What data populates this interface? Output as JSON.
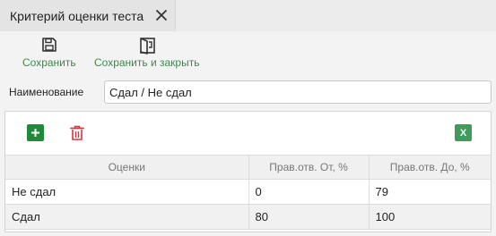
{
  "tab": {
    "title": "Критерий оценки теста"
  },
  "toolbar": {
    "save_label": "Сохранить",
    "save_close_label": "Сохранить и закрыть"
  },
  "form": {
    "name_label": "Наименование",
    "name_value": "Сдал / Не сдал"
  },
  "grid": {
    "export_label": "X",
    "columns": [
      "Оценки",
      "Прав.отв. От, %",
      "Прав.отв. До, %"
    ],
    "rows": [
      [
        "Не сдал",
        "0",
        "79"
      ],
      [
        "Сдал",
        "80",
        "100"
      ]
    ]
  },
  "colors": {
    "accent_green": "#1f8a3b",
    "delete_red": "#d9363e",
    "excel_green": "#3f9a5c"
  },
  "icons": {
    "tab_close": "close-icon",
    "save": "floppy-disk-icon",
    "save_close": "save-and-close-icon",
    "add": "plus-icon",
    "delete": "trash-icon",
    "export": "excel-icon"
  }
}
